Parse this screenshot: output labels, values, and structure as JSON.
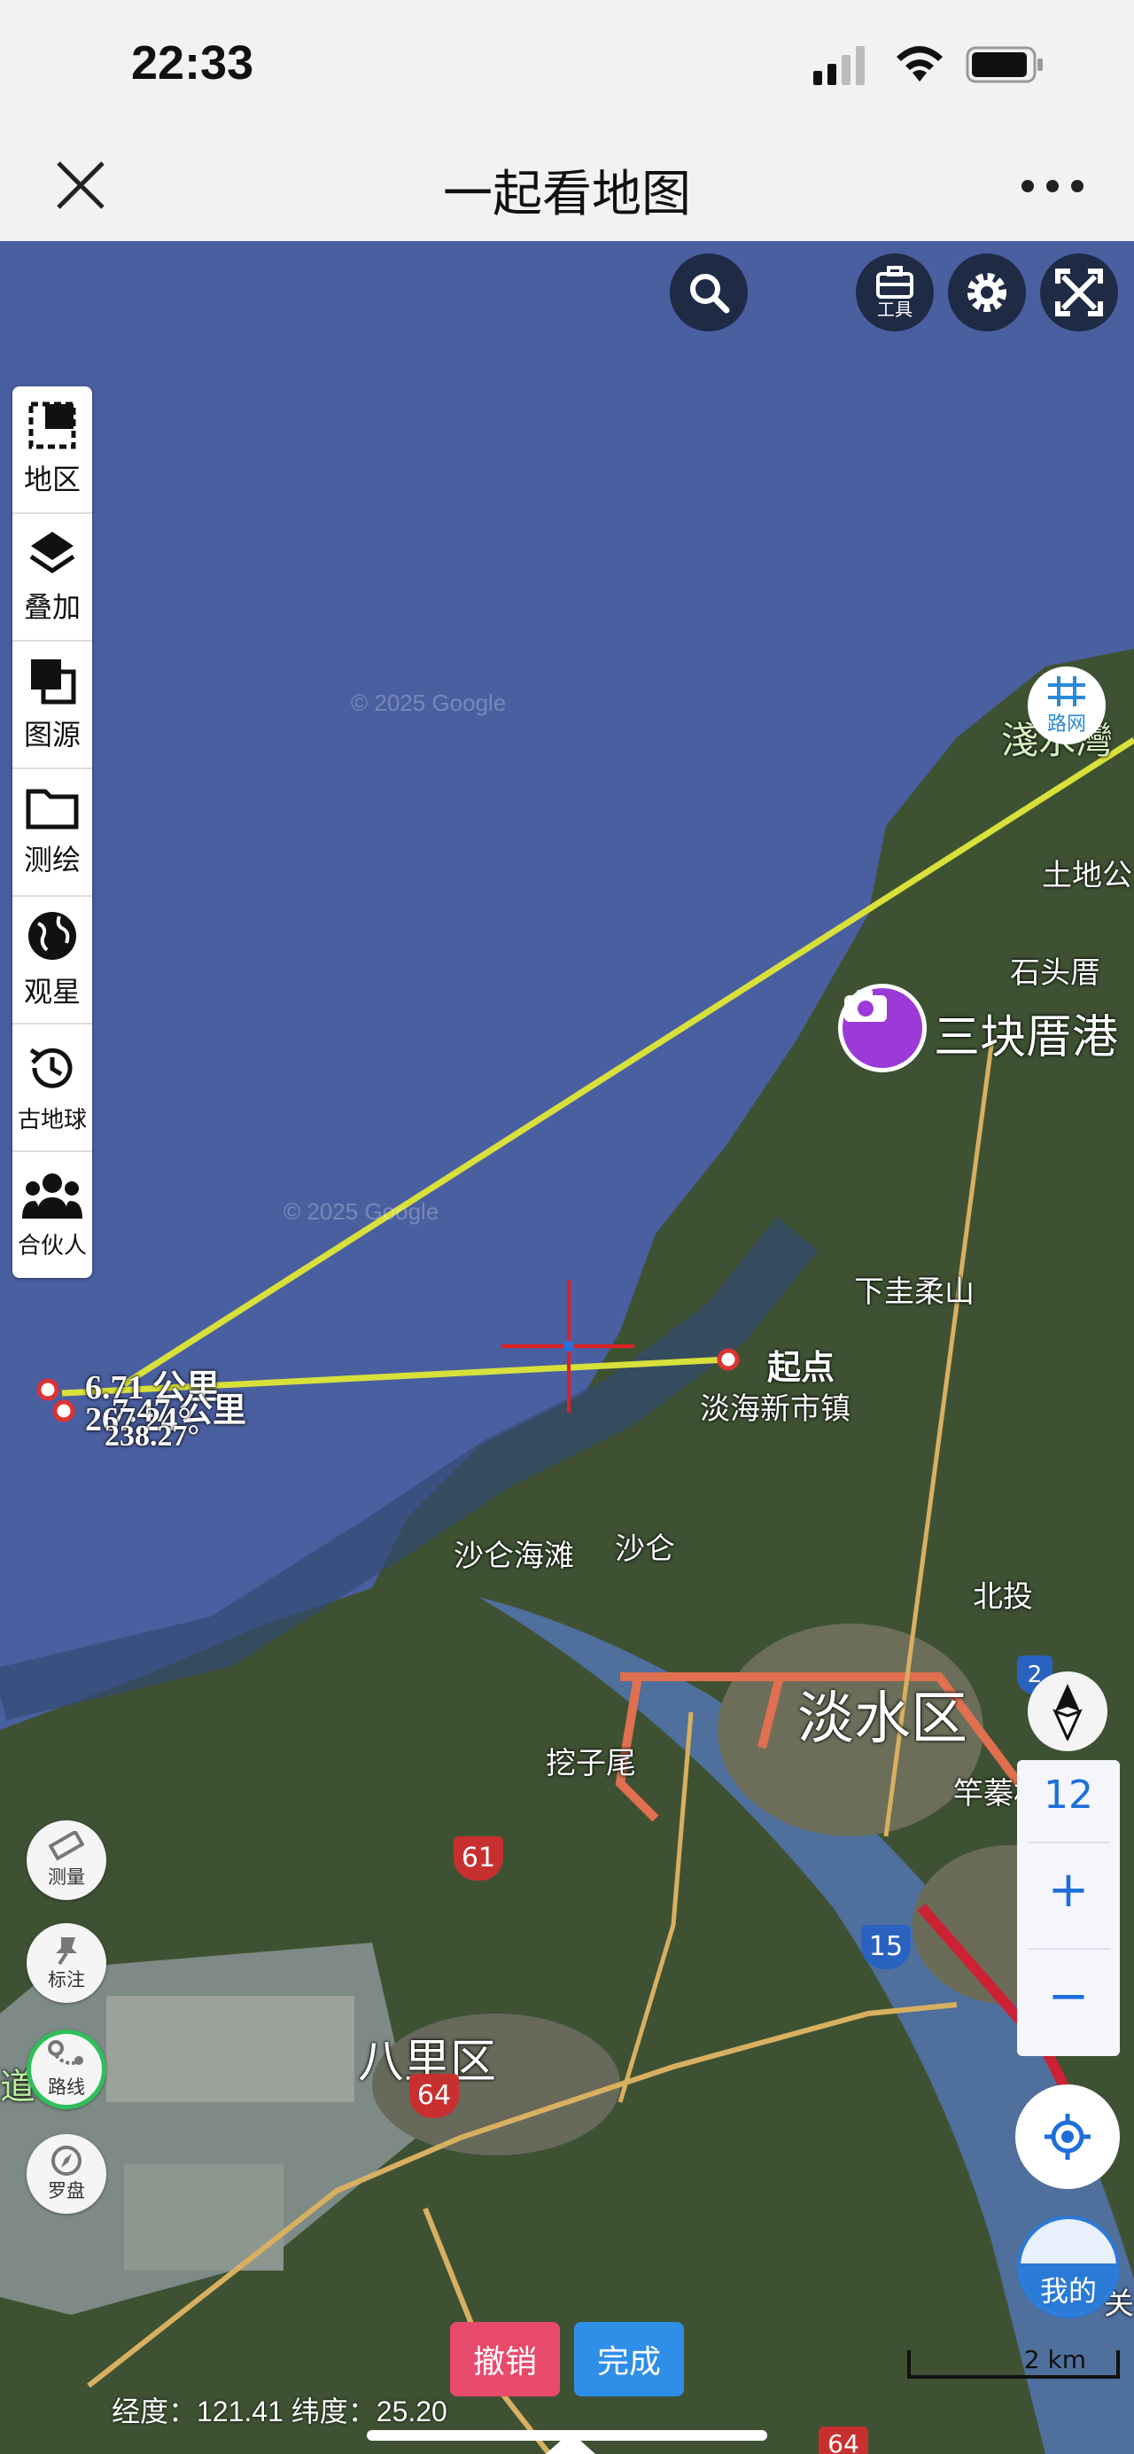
{
  "status_bar": {
    "time": "22:33"
  },
  "header": {
    "title": "一起看地图",
    "close_icon": "close-icon",
    "more_icon": "more-icon"
  },
  "toolbar": {
    "tools_label": "工具"
  },
  "sidebar": {
    "items": [
      {
        "label": "地区",
        "icon": "region-icon"
      },
      {
        "label": "叠加",
        "icon": "layers-icon"
      },
      {
        "label": "图源",
        "icon": "source-icon"
      },
      {
        "label": "测绘",
        "icon": "folder-icon"
      },
      {
        "label": "观星",
        "icon": "globe-icon"
      },
      {
        "label": "古地球",
        "icon": "history-icon"
      },
      {
        "label": "合伙人",
        "icon": "people-icon"
      }
    ]
  },
  "road_network": {
    "label": "路网"
  },
  "left_tools": [
    {
      "label": "测量",
      "icon": "ruler-icon"
    },
    {
      "label": "标注",
      "icon": "pin-icon"
    },
    {
      "label": "路线",
      "icon": "route-icon"
    },
    {
      "label": "罗盘",
      "icon": "compass-icon"
    }
  ],
  "measurement": {
    "start_label": "起点",
    "distance_1": "6.71 公里",
    "distance_2": "7.47 公里",
    "bearing_1": "267.24°",
    "bearing_2": "238.27°"
  },
  "places": {
    "tamsui_label_partial": "淺水灣",
    "tudigong": "土地公",
    "shitoucuo": "石头厝",
    "sankuaicuo": "三块厝港",
    "xiaguirou": "下圭柔山",
    "danhai": "淡海新市镇",
    "shalun_beach": "沙仑海滩",
    "shalun": "沙仑",
    "beitou": "北投",
    "danshui": "淡水区",
    "waziwei": "挖子尾",
    "zhuwei": "竿蓁林",
    "bali": "八里区",
    "dao": "道",
    "guan": "关"
  },
  "road_shields": [
    "61",
    "15",
    "64",
    "2",
    "64"
  ],
  "watermark": "© 2025 Google",
  "zoom": {
    "level": "12",
    "plus": "+",
    "minus": "−"
  },
  "my_location": {
    "label": "我的"
  },
  "actions": {
    "undo": "撤销",
    "done": "完成"
  },
  "scale": {
    "label": "2 km"
  },
  "coordinates": {
    "text": "经度：121.41 纬度：25.20"
  },
  "colors": {
    "ocean": "#4a5fa0",
    "measure_line": "#d8e03a",
    "undo": "#e84a6c",
    "done": "#2f8ee8",
    "accent": "#1e6fd9",
    "crosshair": "#e02020"
  }
}
